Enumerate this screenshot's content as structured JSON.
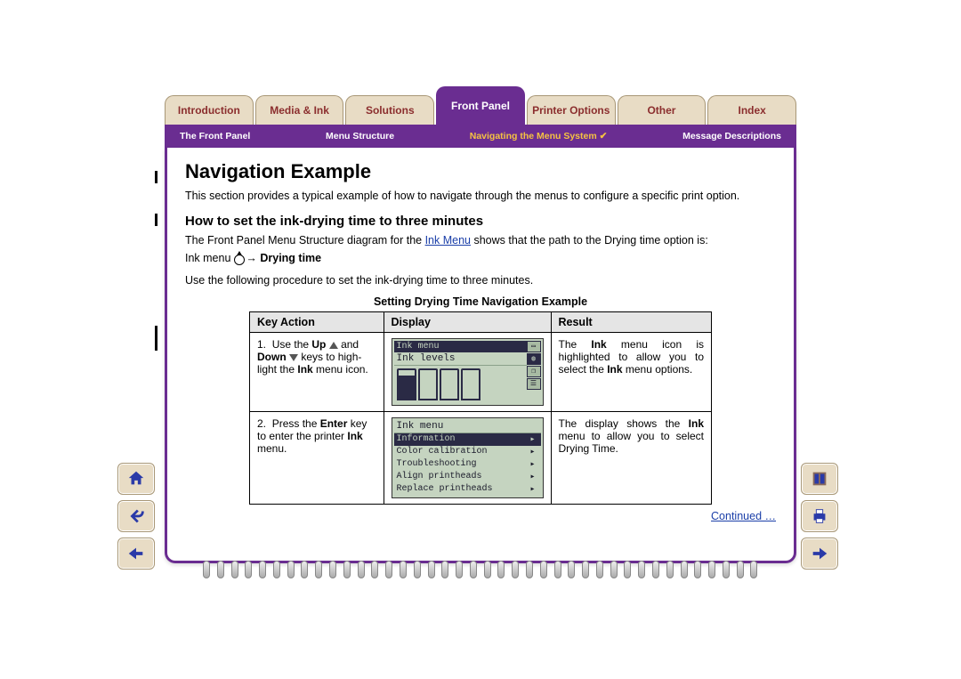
{
  "tabs": [
    {
      "label": "Introduction"
    },
    {
      "label": "Media & Ink"
    },
    {
      "label": "Solutions"
    },
    {
      "label": "Front Panel",
      "active": true
    },
    {
      "label": "Printer Options"
    },
    {
      "label": "Other"
    },
    {
      "label": "Index"
    }
  ],
  "subnav": [
    {
      "label": "The Front Panel"
    },
    {
      "label": "Menu Structure"
    },
    {
      "label": "Navigating the Menu System  ✔",
      "active": true
    },
    {
      "label": "Message Descriptions"
    }
  ],
  "title": "Navigation Example",
  "intro": "This section provides a typical example of how to navigate through the menus to configure a specific print option.",
  "subtitle": "How to set the ink-drying time to three minutes",
  "path_sentence_prefix": "The Front Panel Menu Structure diagram for the ",
  "path_link": "Ink Menu",
  "path_sentence_suffix": " shows that the path to the Drying time option is:",
  "path_formula_prefix": "Ink menu ",
  "path_formula_arrow": " → ",
  "path_formula_bold": "Drying time",
  "procedure_note": "Use the following procedure to set the ink-drying time to three minutes.",
  "table_caption": "Setting Drying Time Navigation Example",
  "columns": {
    "key": "Key Action",
    "display": "Display",
    "result": "Result"
  },
  "rows": [
    {
      "num": "1.",
      "key_prefix": "Use the ",
      "key_bold1": "Up",
      "key_mid1": " ",
      "key_after_icon1": " and ",
      "key_bold2": "Down",
      "key_mid2": " ",
      "key_after_icon2": " keys to high­light the ",
      "key_bold3": "Ink",
      "key_suffix": " menu icon.",
      "display": {
        "header": "Ink menu",
        "line2": "Ink levels",
        "show_cartridges": true
      },
      "result_prefix": "The ",
      "result_bold1": "Ink",
      "result_mid": " menu icon is highlighted to allow you to select the ",
      "result_bold2": "Ink",
      "result_suffix": " menu options."
    },
    {
      "num": "2.",
      "key_prefix": "Press the ",
      "key_bold1": "Enter",
      "key_mid1": " key to enter the printer ",
      "key_bold2": "Ink",
      "key_suffix": " menu.",
      "display": {
        "header": "Ink menu",
        "menu_items": [
          "Information",
          "Color calibration",
          "Troubleshooting",
          "Align printheads",
          "Replace printheads"
        ],
        "selected_index": 0
      },
      "result_prefix": "The display shows the ",
      "result_bold1": "Ink",
      "result_mid": " menu to allow you to select Drying Time.",
      "result_bold2": "",
      "result_suffix": ""
    }
  ],
  "continued": "Continued …",
  "side_buttons": {
    "home": "home-icon",
    "back": "back-icon",
    "prev": "prev-page-icon",
    "exit": "exit-icon",
    "print": "print-icon",
    "next": "next-page-icon"
  }
}
